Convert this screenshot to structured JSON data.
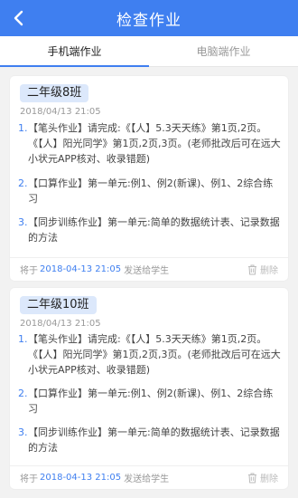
{
  "header": {
    "title": "检查作业"
  },
  "tabs": [
    {
      "label": "手机端作业",
      "active": true
    },
    {
      "label": "电脑端作业",
      "active": false
    }
  ],
  "cards": [
    {
      "class_name": "二年级8班",
      "date": "2018/04/13 21:05",
      "tasks": [
        {
          "num": "1.",
          "text": "【笔头作业】请完成:《【人】5.3天天练》第1页,2页。《【人】阳光同学》第1页,2页,3页。(老师批改后可在远大小状元APP核对、收录错题)"
        },
        {
          "num": "2.",
          "text": "【口算作业】第一单元:例1、例2(新课)、例1、2综合练习"
        },
        {
          "num": "3.",
          "text": "【同步训练作业】第一单元:简单的数据统计表、记录数据的方法"
        }
      ],
      "footer": {
        "prefix": "将于",
        "time": "2018-04-13 21:05",
        "suffix": "发送给学生",
        "delete_label": "删除"
      }
    },
    {
      "class_name": "二年级10班",
      "date": "2018/04/13 21:05",
      "tasks": [
        {
          "num": "1.",
          "text": "【笔头作业】请完成:《【人】5.3天天练》第1页,2页。《【人】阳光同学》第1页,2页,3页。(老师批改后可在远大小状元APP核对、收录错题)"
        },
        {
          "num": "2.",
          "text": "【口算作业】第一单元:例1、例2(新课)、例1、2综合练习"
        },
        {
          "num": "3.",
          "text": "【同步训练作业】第一单元:简单的数据统计表、记录数据的方法"
        }
      ],
      "footer": {
        "prefix": "将于",
        "time": "2018-04-13 21:05",
        "suffix": "发送给学生",
        "delete_label": "删除"
      }
    }
  ],
  "colors": {
    "primary": "#3f7ff0",
    "tag_bg": "#dce8fb"
  }
}
